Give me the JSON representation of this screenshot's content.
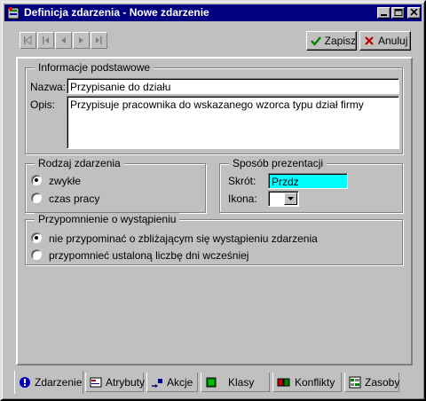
{
  "window": {
    "title": "Definicja zdarzenia - Nowe zdarzenie"
  },
  "toolbar": {
    "save_label": "Zapisz",
    "cancel_label": "Anuluj"
  },
  "basic_info": {
    "legend": "Informacje podstawowe",
    "name_label": "Nazwa:",
    "name_value": "Przypisanie do działu",
    "desc_label": "Opis:",
    "desc_value": "Przypisuje pracownika do wskazanego wzorca typu dział firmy"
  },
  "event_type": {
    "legend": "Rodzaj zdarzenia",
    "options": [
      {
        "label": "zwykłe",
        "selected": true
      },
      {
        "label": "czas pracy",
        "selected": false
      }
    ]
  },
  "presentation": {
    "legend": "Sposób prezentacji",
    "short_label": "Skrót:",
    "short_value": "Przdz",
    "short_bg": "#00ffff",
    "icon_label": "Ikona:"
  },
  "reminder": {
    "legend": "Przypomnienie o wystąpieniu",
    "options": [
      {
        "label": "nie przypominać o zbliżającym się wystąpieniu zdarzenia",
        "selected": true
      },
      {
        "label": "przypomnieć ustaloną liczbę dni wcześniej",
        "selected": false
      }
    ]
  },
  "tabs": [
    {
      "label": "Zdarzenie",
      "icon": "info-icon",
      "active": true
    },
    {
      "label": "Atrybuty",
      "icon": "attributes-icon",
      "active": false
    },
    {
      "label": "Akcje",
      "icon": "actions-icon",
      "active": false
    },
    {
      "label": "Klasy",
      "icon": "classes-icon",
      "active": false
    },
    {
      "label": "Konflikty",
      "icon": "conflicts-icon",
      "active": false
    },
    {
      "label": "Zasoby",
      "icon": "resources-icon",
      "active": false
    }
  ],
  "colors": {
    "titlebar": "#000080",
    "face": "#c0c0c0",
    "save_check": "#008000",
    "cancel_x": "#c00000"
  }
}
